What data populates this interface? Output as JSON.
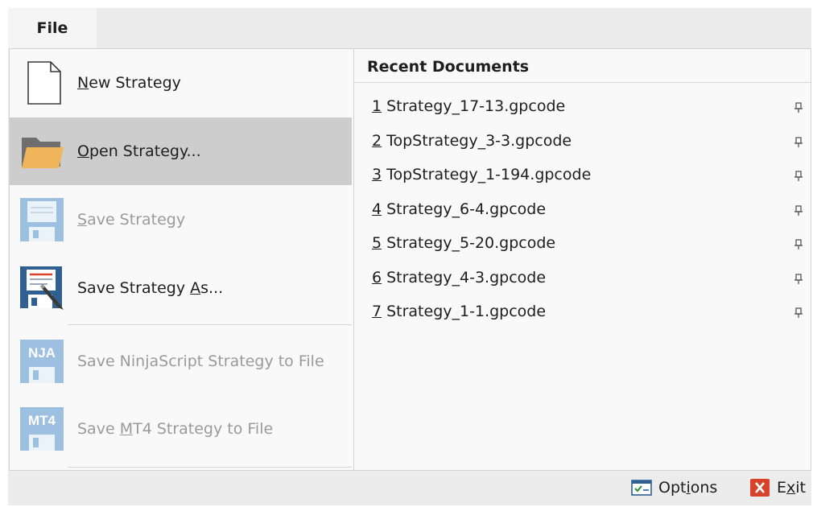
{
  "tab": {
    "file_label": "File"
  },
  "menu": {
    "new_strategy": {
      "mnemonic": "N",
      "rest": "ew Strategy"
    },
    "open_strategy": {
      "mnemonic": "O",
      "rest": "pen Strategy..."
    },
    "save_strategy": {
      "mnemonic": "S",
      "rest": "ave Strategy"
    },
    "save_strategy_as": {
      "pre": "Save Strategy ",
      "mnemonic": "A",
      "rest": "s..."
    },
    "save_nja": {
      "label": "Save NinjaScript Strategy to File",
      "icon_text": "NJA"
    },
    "save_mt4": {
      "pre": "Save ",
      "mnemonic": "M",
      "rest": "T4 Strategy to File",
      "icon_text": "MT4"
    }
  },
  "recent": {
    "header": "Recent Documents",
    "items": [
      {
        "num": "1",
        "name": "Strategy_17-13.gpcode"
      },
      {
        "num": "2",
        "name": "TopStrategy_3-3.gpcode"
      },
      {
        "num": "3",
        "name": "TopStrategy_1-194.gpcode"
      },
      {
        "num": "4",
        "name": "Strategy_6-4.gpcode"
      },
      {
        "num": "5",
        "name": "Strategy_5-20.gpcode"
      },
      {
        "num": "6",
        "name": "Strategy_4-3.gpcode"
      },
      {
        "num": "7",
        "name": "Strategy_1-1.gpcode"
      }
    ]
  },
  "footer": {
    "options": {
      "pre": "Opt",
      "mnemonic": "i",
      "rest": "ons"
    },
    "exit": {
      "pre": "E",
      "mnemonic": "x",
      "rest": "it"
    }
  },
  "colors": {
    "selected_bg": "#cdcdcd",
    "disabled_text": "#9a9a9a",
    "folder": "#f0b45a",
    "disk_blue": "#2f5f93",
    "disk_disabled": "#9dbfe0",
    "exit_red": "#d9412b"
  },
  "icons": [
    "document-icon",
    "folder-icon",
    "floppy-disabled-icon",
    "floppy-pen-icon",
    "nja-floppy-icon",
    "mt4-floppy-icon",
    "pin-icon",
    "options-icon",
    "exit-icon"
  ]
}
